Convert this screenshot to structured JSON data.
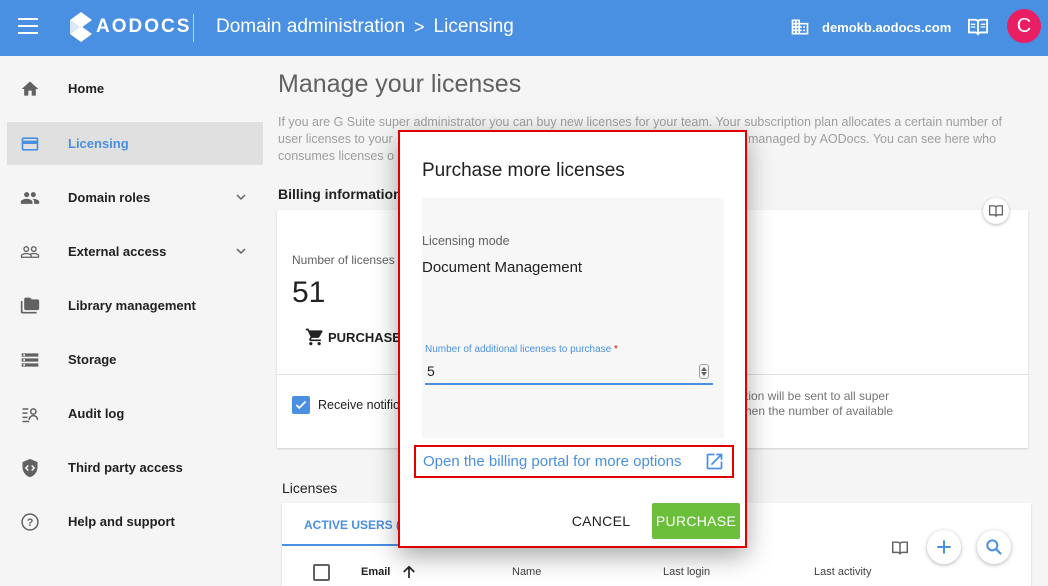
{
  "topbar": {
    "logo_text": "AODOCS",
    "breadcrumb_parent": "Domain administration",
    "breadcrumb_separator": ">",
    "breadcrumb_current": "Licensing",
    "domain": "demokb.aodocs.com",
    "avatar_letter": "C",
    "accent_color": "#4a90e2"
  },
  "sidebar": {
    "items": [
      {
        "label": "Home",
        "icon": "home-icon"
      },
      {
        "label": "Licensing",
        "icon": "card-icon",
        "active": true
      },
      {
        "label": "Domain roles",
        "icon": "people-icon",
        "expandable": true
      },
      {
        "label": "External access",
        "icon": "people-outline-icon",
        "expandable": true
      },
      {
        "label": "Library management",
        "icon": "folders-icon"
      },
      {
        "label": "Storage",
        "icon": "storage-icon"
      },
      {
        "label": "Audit log",
        "icon": "audit-log-icon"
      },
      {
        "label": "Third party access",
        "icon": "shield-icon"
      },
      {
        "label": "Help and support",
        "icon": "help-icon"
      }
    ]
  },
  "main": {
    "title": "Manage your licenses",
    "intro_line1": "If you are G Suite super administrator you can buy new licenses for your team. Your subscription plan allocates a certain number of",
    "intro_line2_left": "user licenses to your",
    "intro_line2_right": "managed by AODocs. You can see here who",
    "intro_line3_left": "consumes licenses o",
    "billing_title": "Billing information",
    "num_licenses_label": "Number of licenses",
    "num_licenses_value": "51",
    "purchase_label": "PURCHASE",
    "notif_label": "Receive notific",
    "notif_right_line1": "tion will be sent to all super",
    "notif_right_line2": "hen the number of available",
    "licenses_title": "Licenses",
    "tab_active_users": "ACTIVE USERS (",
    "columns": [
      "Email",
      "Name",
      "Last login",
      "Last activity"
    ]
  },
  "dialog": {
    "title": "Purchase more licenses",
    "mode_label": "Licensing mode",
    "mode_value": "Document Management",
    "qty_label": "Number of additional licenses to purchase",
    "qty_required": "*",
    "qty_value": "5",
    "billing_link": "Open the billing portal for more options",
    "cancel_label": "CANCEL",
    "purchase_label": "PURCHASE",
    "purchase_color": "#6bbf3a",
    "highlight_color": "#e00000"
  }
}
